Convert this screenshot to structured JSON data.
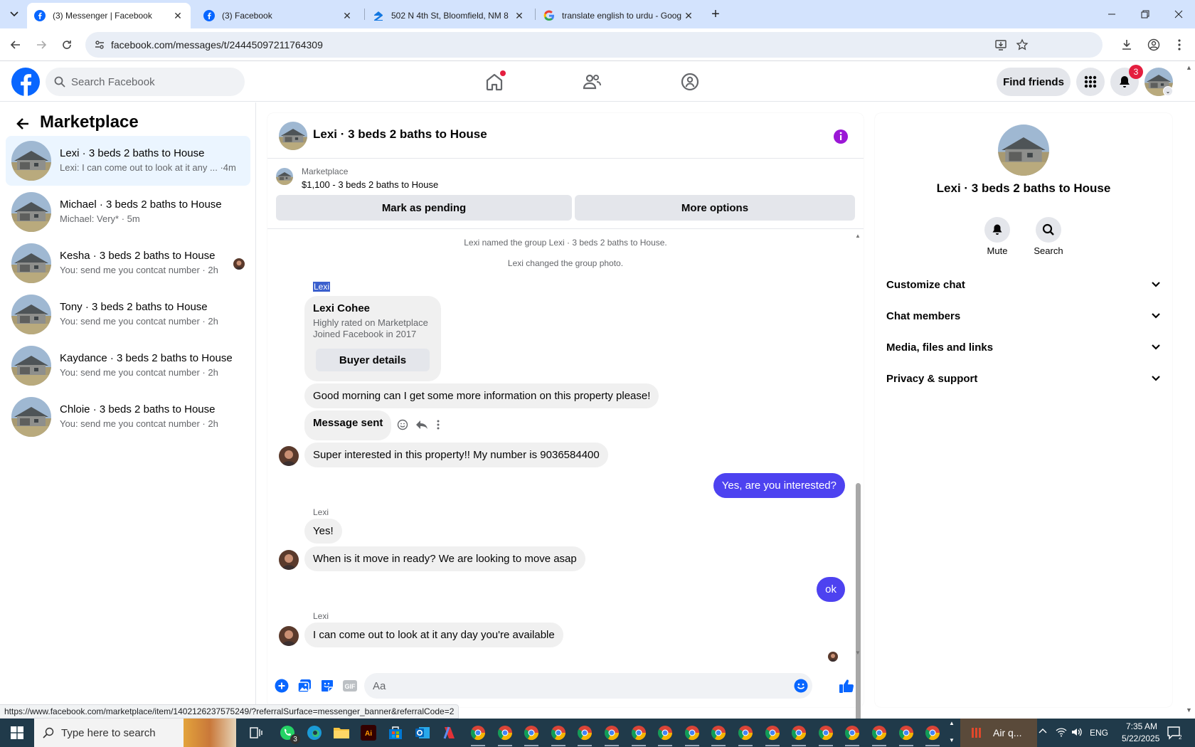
{
  "browser": {
    "tabs": [
      {
        "title": "(3) Messenger | Facebook",
        "active": true
      },
      {
        "title": "(3) Facebook",
        "active": false
      },
      {
        "title": "502 N 4th St, Bloomfield, NM 8",
        "active": false
      },
      {
        "title": "translate english to urdu - Goog",
        "active": false
      }
    ],
    "url": "facebook.com/messages/t/24445097211764309",
    "status_url": "https://www.facebook.com/marketplace/item/1402126237575249/?referralSurface=messenger_banner&referralCode=2"
  },
  "fb_header": {
    "search_placeholder": "Search Facebook",
    "find_friends": "Find friends",
    "notification_count": "3"
  },
  "sidebar": {
    "title": "Marketplace",
    "conversations": [
      {
        "name": "Lexi · 3 beds 2 baths to House",
        "preview": "Lexi: I can come out to look at it any ... ·4m",
        "active": true
      },
      {
        "name": "Michael · 3 beds 2 baths to House",
        "preview": "Michael: Very* · 5m",
        "active": false
      },
      {
        "name": "Kesha · 3 beds 2 baths to House",
        "preview": "You: send me you contcat number · 2h",
        "active": false
      },
      {
        "name": "Tony · 3 beds 2 baths to House",
        "preview": "You: send me you contcat number · 2h",
        "active": false
      },
      {
        "name": "Kaydance · 3 beds 2 baths to House",
        "preview": "You: send me you contcat number · 2h",
        "active": false
      },
      {
        "name": "Chloie · 3 beds 2 baths to House",
        "preview": "You: send me you contcat number · 2h",
        "active": false
      }
    ]
  },
  "chat": {
    "title": "Lexi · 3 beds 2 baths to House",
    "banner": {
      "source": "Marketplace",
      "listing": "$1,100 - 3 beds 2 baths to House",
      "pending_button": "Mark as pending",
      "more_button": "More options"
    },
    "system_messages": [
      "Lexi named the group Lexi · 3 beds 2 baths to House.",
      "Lexi changed the group photo."
    ],
    "buyer_card": {
      "label": "Lexi",
      "name": "Lexi Cohee",
      "line1": "Highly rated on Marketplace",
      "line2": "Joined Facebook in 2017",
      "button": "Buyer details"
    },
    "messages": [
      {
        "from": "them",
        "text": "Good morning can I get some more information on this property please!"
      },
      {
        "from": "them",
        "text": "Message sent"
      },
      {
        "from": "them",
        "text": "Super interested in this property!! My number is 9036584400"
      },
      {
        "from": "me",
        "text": "Yes, are you interested?"
      },
      {
        "from": "them",
        "sender": "Lexi",
        "text": "Yes!"
      },
      {
        "from": "them",
        "text": "When is it move in ready? We are looking to move asap"
      },
      {
        "from": "me",
        "text": "ok"
      },
      {
        "from": "them",
        "sender": "Lexi",
        "text": "I can come out to look at it any day you're available"
      }
    ],
    "composer_placeholder": "Aa"
  },
  "details": {
    "title": "Lexi · 3 beds 2 baths to House",
    "actions": [
      "Mute",
      "Search"
    ],
    "sections": [
      "Customize chat",
      "Chat members",
      "Media, files and links",
      "Privacy & support"
    ]
  },
  "taskbar": {
    "search_placeholder": "Type here to search",
    "weather": "Air q...",
    "lang": "ENG",
    "time": "7:35 AM",
    "date": "5/22/2025",
    "whatsapp_badge": "3"
  },
  "colors": {
    "fb_blue": "#0866ff",
    "me_bubble": "#4d42f0",
    "notif_red": "#e41e3f",
    "info_purple": "#9b17d6"
  }
}
